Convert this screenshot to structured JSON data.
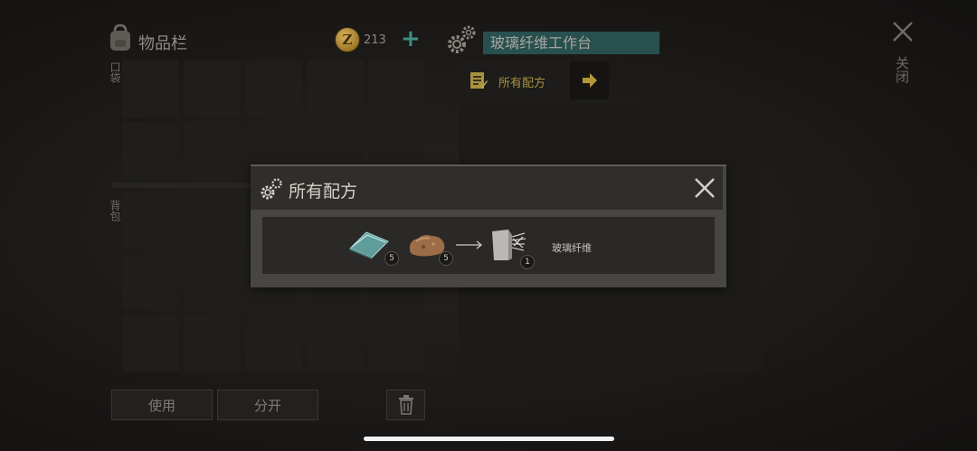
{
  "inventory": {
    "title": "物品栏",
    "coins": "213",
    "coin_symbol": "Z",
    "add_label": "+",
    "pocket_label": "口袋",
    "backpack_label": "背包",
    "pocket_slots": 10,
    "backpack_slots": 15,
    "buttons": {
      "use": "使用",
      "split": "分开"
    }
  },
  "workbench": {
    "name": "玻璃纤维工作台",
    "recipes_tab": "所有配方",
    "close_label": "关闭"
  },
  "modal": {
    "title": "所有配方",
    "recipe": {
      "ingredients": [
        {
          "icon": "glass-sheet-icon",
          "count": "5"
        },
        {
          "icon": "ore-rock-icon",
          "count": "5"
        }
      ],
      "result": {
        "icon": "fiberglass-icon",
        "count": "1",
        "label": "玻璃纤维"
      }
    }
  },
  "colors": {
    "accent_teal": "#3d8f84",
    "tab_gold": "#a9913f",
    "input_teal": "#27504f"
  }
}
